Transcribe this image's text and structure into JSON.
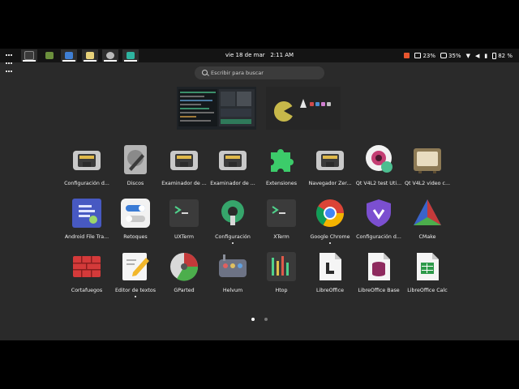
{
  "topbar": {
    "clock_date": "vie 18 de mar",
    "clock_time": "2:11 AM",
    "status": {
      "storage": "23%",
      "memory": "35%",
      "battery": "82 %"
    },
    "tasks": [
      {
        "icon": "terminal-icon",
        "color": "#3a3a3a"
      },
      {
        "icon": "android-icon",
        "color": "#6b8f3c"
      },
      {
        "icon": "ship-icon",
        "color": "#3f7fd4"
      },
      {
        "icon": "notes-icon",
        "color": "#e8d27a"
      },
      {
        "icon": "chrome-icon",
        "color": "#bbbbbb"
      },
      {
        "icon": "vector-icon",
        "color": "#2eb4a0"
      }
    ]
  },
  "search": {
    "placeholder": "Escribir para buscar"
  },
  "apps": [
    {
      "label": "Configuración d...",
      "icon": "network-icon",
      "running": false
    },
    {
      "label": "Discos",
      "icon": "disks-icon",
      "running": false
    },
    {
      "label": "Examinador de ...",
      "icon": "network-icon",
      "running": false
    },
    {
      "label": "Examinador de ...",
      "icon": "network-icon",
      "running": false
    },
    {
      "label": "Extensiones",
      "icon": "puzzle-icon",
      "running": false
    },
    {
      "label": "Navegador Zer...",
      "icon": "network-icon",
      "running": false
    },
    {
      "label": "Qt V4L2 test Uti...",
      "icon": "webcam-icon",
      "running": false
    },
    {
      "label": "Qt V4L2 video c...",
      "icon": "tv-icon",
      "running": false
    },
    {
      "label": "Android File Tra...",
      "icon": "android-file-icon",
      "running": false
    },
    {
      "label": "Retoques",
      "icon": "tweaks-icon",
      "running": false
    },
    {
      "label": "UXTerm",
      "icon": "terminal-icon",
      "running": false
    },
    {
      "label": "Configuración",
      "icon": "settings-icon",
      "running": true
    },
    {
      "label": "XTerm",
      "icon": "terminal-icon",
      "running": false
    },
    {
      "label": "Google Chrome",
      "icon": "chrome-icon",
      "running": true
    },
    {
      "label": "Configuración d...",
      "icon": "shield-icon",
      "running": false
    },
    {
      "label": "CMake",
      "icon": "cmake-icon",
      "running": false
    },
    {
      "label": "Cortafuegos",
      "icon": "firewall-icon",
      "running": false
    },
    {
      "label": "Editor de textos",
      "icon": "text-editor-icon",
      "running": true
    },
    {
      "label": "GParted",
      "icon": "gparted-icon",
      "running": false
    },
    {
      "label": "Helvum",
      "icon": "helvum-icon",
      "running": false
    },
    {
      "label": "Htop",
      "icon": "htop-icon",
      "running": false
    },
    {
      "label": "LibreOffice",
      "icon": "libreoffice-icon",
      "running": false
    },
    {
      "label": "LibreOffice Base",
      "icon": "libreoffice-base-icon",
      "running": false
    },
    {
      "label": "LibreOffice Calc",
      "icon": "libreoffice-calc-icon",
      "running": false
    }
  ],
  "pagination": {
    "pages": 2,
    "current": 1
  }
}
